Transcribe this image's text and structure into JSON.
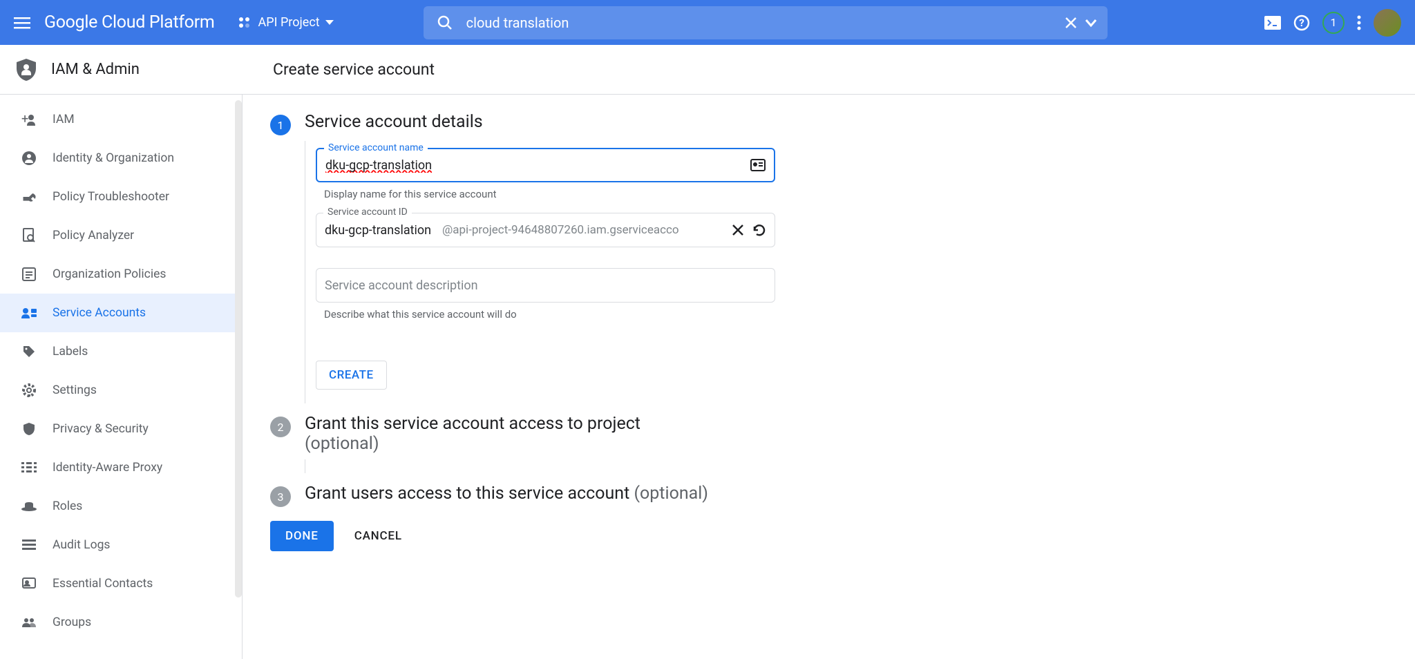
{
  "header": {
    "logo": "Google Cloud Platform",
    "project_name": "API Project",
    "search_value": "cloud translation",
    "notification_count": "1"
  },
  "subheader": {
    "section": "IAM & Admin",
    "page_title": "Create service account"
  },
  "sidebar": {
    "items": [
      {
        "label": "IAM",
        "icon": "person-add"
      },
      {
        "label": "Identity & Organization",
        "icon": "person-circle"
      },
      {
        "label": "Policy Troubleshooter",
        "icon": "wrench"
      },
      {
        "label": "Policy Analyzer",
        "icon": "doc-search"
      },
      {
        "label": "Organization Policies",
        "icon": "list"
      },
      {
        "label": "Service Accounts",
        "icon": "service-account"
      },
      {
        "label": "Labels",
        "icon": "tag"
      },
      {
        "label": "Settings",
        "icon": "gear"
      },
      {
        "label": "Privacy & Security",
        "icon": "shield-small"
      },
      {
        "label": "Identity-Aware Proxy",
        "icon": "proxy"
      },
      {
        "label": "Roles",
        "icon": "hat"
      },
      {
        "label": "Audit Logs",
        "icon": "logs"
      },
      {
        "label": "Essential Contacts",
        "icon": "contact"
      },
      {
        "label": "Groups",
        "icon": "groups"
      }
    ]
  },
  "steps": {
    "s1": {
      "num": "1",
      "title": "Service account details",
      "name_label": "Service account name",
      "name_value": "dku-gcp-translation",
      "name_helper": "Display name for this service account",
      "id_label": "Service account ID",
      "id_value": "dku-gcp-translation",
      "id_suffix": "@api-project-94648807260.iam.gserviceacco",
      "desc_placeholder": "Service account description",
      "desc_helper": "Describe what this service account will do",
      "create_label": "CREATE"
    },
    "s2": {
      "num": "2",
      "title": "Grant this service account access to project",
      "optional": "(optional)"
    },
    "s3": {
      "num": "3",
      "title": "Grant users access to this service account ",
      "optional": "(optional)"
    }
  },
  "actions": {
    "done": "DONE",
    "cancel": "CANCEL"
  }
}
